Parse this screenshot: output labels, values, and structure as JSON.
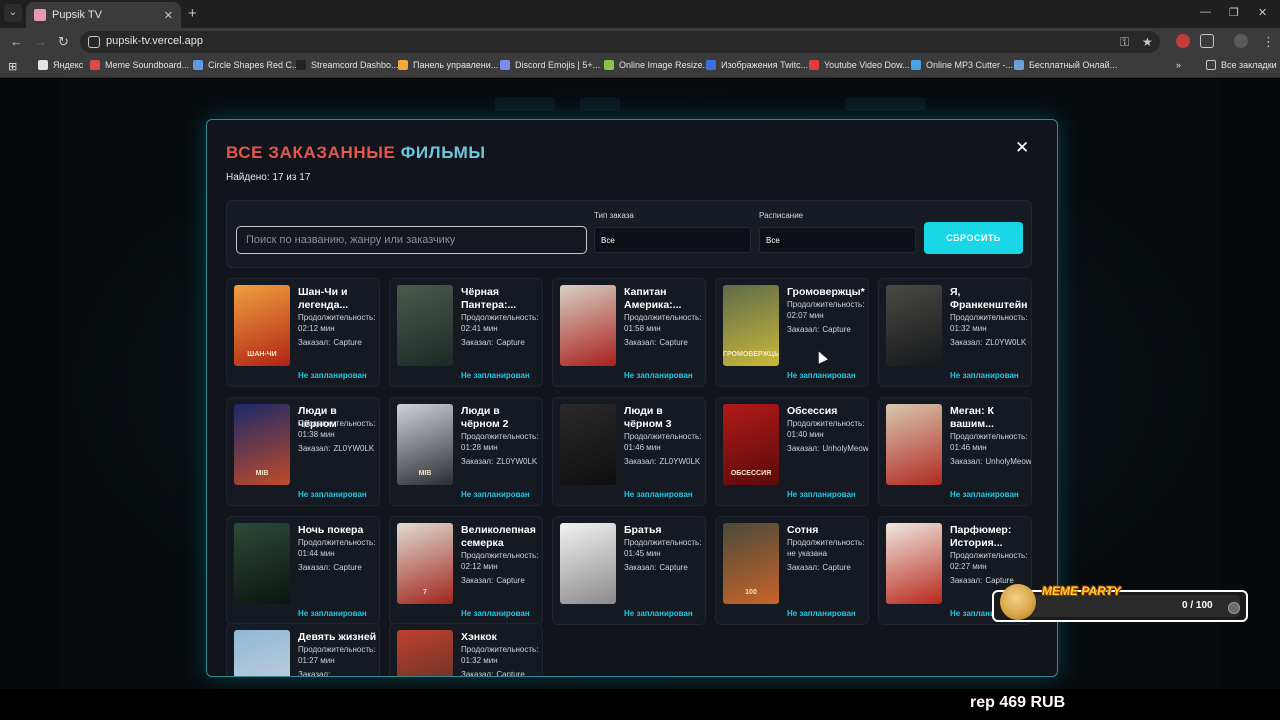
{
  "browser": {
    "tab_title": "Pupsik TV",
    "url": "pupsik-tv.vercel.app",
    "bookmarks": [
      {
        "label": "Яндекс",
        "color": "#e3e3e3"
      },
      {
        "label": "Meme Soundboard...",
        "color": "#d94b4b"
      },
      {
        "label": "Circle Shapes Red C...",
        "color": "#5e9be0"
      },
      {
        "label": "Streamcord Dashbo...",
        "color": "#222222"
      },
      {
        "label": "Панель управлени...",
        "color": "#f2a93b"
      },
      {
        "label": "Discord Emojis | 5+...",
        "color": "#7b8cf0"
      },
      {
        "label": "Online Image Resize...",
        "color": "#8bc34a"
      },
      {
        "label": "Изображения Twitc...",
        "color": "#3b6fe0"
      },
      {
        "label": "Youtube Video Dow...",
        "color": "#e23b3b"
      },
      {
        "label": "Online MP3 Cutter -...",
        "color": "#4fa3e0"
      },
      {
        "label": "Бесплатный Онлай...",
        "color": "#6fa0d8"
      }
    ],
    "all_bookmarks": "Все закладки"
  },
  "modal": {
    "title_part1": "ВСЕ ЗАКАЗАННЫЕ",
    "title_part2": "ФИЛЬМЫ",
    "found_text": "Найдено: 17 из 17",
    "close_symbol": "✕",
    "search_placeholder": "Поиск по названию, жанру или заказчику",
    "order_type_label": "Тип заказа",
    "order_type_value": "Все",
    "schedule_label": "Расписание",
    "schedule_value": "Все",
    "reset_label": "СБРОСИТЬ"
  },
  "films": [
    {
      "title": "Шан-Чи и легенда...",
      "duration_label": "Продолжительность:",
      "duration": "02:12 мин",
      "ordered_by_label": "Заказал:",
      "ordered_by": "Capture",
      "status": "Не запланирован",
      "poster_text": "ШАН-ЧИ",
      "poster_colors": [
        "#f0a040",
        "#b02414"
      ]
    },
    {
      "title": "Чёрная Пантера:...",
      "duration_label": "Продолжительность:",
      "duration": "02:41 мин",
      "ordered_by_label": "Заказал:",
      "ordered_by": "Capture",
      "status": "Не запланирован",
      "poster_text": "",
      "poster_colors": [
        "#4c5a4e",
        "#1a2a26"
      ]
    },
    {
      "title": "Капитан Америка:...",
      "duration_label": "Продолжительность:",
      "duration": "01:58 мин",
      "ordered_by_label": "Заказал:",
      "ordered_by": "Capture",
      "status": "Не запланирован",
      "poster_text": "",
      "poster_colors": [
        "#d8d0c4",
        "#a8201c"
      ]
    },
    {
      "title": "Громовержцы*",
      "duration_label": "Продолжительность:",
      "duration": "02:07 мин",
      "ordered_by_label": "Заказал:",
      "ordered_by": "Capture",
      "status": "Не запланирован",
      "poster_text": "ГРОМОВЕРЖЦЫ",
      "poster_colors": [
        "#5f6a4a",
        "#c9b93a"
      ]
    },
    {
      "title": "Я, Франкенштейн",
      "duration_label": "Продолжительность:",
      "duration": "01:32 мин",
      "ordered_by_label": "Заказал:",
      "ordered_by": "ZL0YW0LK",
      "status": "Не запланирован",
      "poster_text": "",
      "poster_colors": [
        "#4a4a44",
        "#15171a"
      ]
    },
    {
      "title": "Люди в чёрном",
      "duration_label": "Продолжительность:",
      "duration": "01:38 мин",
      "ordered_by_label": "Заказал:",
      "ordered_by": "ZL0YW0LK",
      "status": "Не запланирован",
      "poster_text": "MIB",
      "poster_colors": [
        "#1a2a6a",
        "#c04a2a"
      ]
    },
    {
      "title": "Люди в чёрном 2",
      "duration_label": "Продолжительность:",
      "duration": "01:28 мин",
      "ordered_by_label": "Заказал:",
      "ordered_by": "ZL0YW0LK",
      "status": "Не запланирован",
      "poster_text": "MIB",
      "poster_colors": [
        "#cfd2d6",
        "#2a2d33"
      ]
    },
    {
      "title": "Люди в чёрном 3",
      "duration_label": "Продолжительность:",
      "duration": "01:46 мин",
      "ordered_by_label": "Заказал:",
      "ordered_by": "ZL0YW0LK",
      "status": "Не запланирован",
      "poster_text": "",
      "poster_colors": [
        "#2a2a2a",
        "#0e0e0e"
      ]
    },
    {
      "title": "Обсессия",
      "duration_label": "Продолжительность:",
      "duration": "01:40 мин",
      "ordered_by_label": "Заказал:",
      "ordered_by": "UnholyMeow",
      "status": "Не запланирован",
      "poster_text": "ОБСЕССИЯ",
      "poster_colors": [
        "#b21a1a",
        "#5a0a0a"
      ]
    },
    {
      "title": "Меган: К вашим...",
      "duration_label": "Продолжительность:",
      "duration": "01:46 мин",
      "ordered_by_label": "Заказал:",
      "ordered_by": "UnholyMeow",
      "status": "Не запланирован",
      "poster_text": "",
      "poster_colors": [
        "#d8c8b0",
        "#b02a22"
      ]
    },
    {
      "title": "Ночь покера",
      "duration_label": "Продолжительность:",
      "duration": "01:44 мин",
      "ordered_by_label": "Заказал:",
      "ordered_by": "Capture",
      "status": "Не запланирован",
      "poster_text": "",
      "poster_colors": [
        "#2e4a3a",
        "#0a1410"
      ]
    },
    {
      "title": "Великолепная семерка",
      "duration_label": "Продолжительность:",
      "duration": "02:12 мин",
      "ordered_by_label": "Заказал:",
      "ordered_by": "Capture",
      "status": "Не запланирован",
      "poster_text": "7",
      "poster_colors": [
        "#e0dcd2",
        "#a0241c"
      ]
    },
    {
      "title": "Братья",
      "duration_label": "Продолжительность:",
      "duration": "01:45 мин",
      "ordered_by_label": "Заказал:",
      "ordered_by": "Capture",
      "status": "Не запланирован",
      "poster_text": "",
      "poster_colors": [
        "#f2f2f2",
        "#8a8a8a"
      ]
    },
    {
      "title": "Сотня",
      "duration_label": "Продолжительность:",
      "duration": "не указана",
      "ordered_by_label": "Заказал:",
      "ordered_by": "Capture",
      "status": "Не запланирован",
      "poster_text": "100",
      "poster_colors": [
        "#4a4a3a",
        "#c9642a"
      ]
    },
    {
      "title": "Парфюмер: История...",
      "duration_label": "Продолжительность:",
      "duration": "02:27 мин",
      "ordered_by_label": "Заказал:",
      "ordered_by": "Capture",
      "status": "Не запланирован",
      "poster_text": "",
      "poster_colors": [
        "#efe8e0",
        "#b8281c"
      ]
    },
    {
      "title": "Девять жизней",
      "duration_label": "Продолжительность:",
      "duration": "01:27 мин",
      "ordered_by_label": "Заказал:",
      "ordered_by": "",
      "status": "",
      "poster_text": "",
      "poster_colors": [
        "#8fb8d8",
        "#d0d4d8"
      ]
    },
    {
      "title": "Хэнкок",
      "duration_label": "Продолжительность:",
      "duration": "01:32 мин",
      "ordered_by_label": "Заказал:",
      "ordered_by": "Capture",
      "status": "",
      "poster_text": "",
      "poster_colors": [
        "#c04030",
        "#4a3020"
      ]
    }
  ],
  "overlay": {
    "meme_title": "MEME PARTY",
    "meme_count": "0 / 100",
    "ticker": "rep 469 RUB"
  }
}
